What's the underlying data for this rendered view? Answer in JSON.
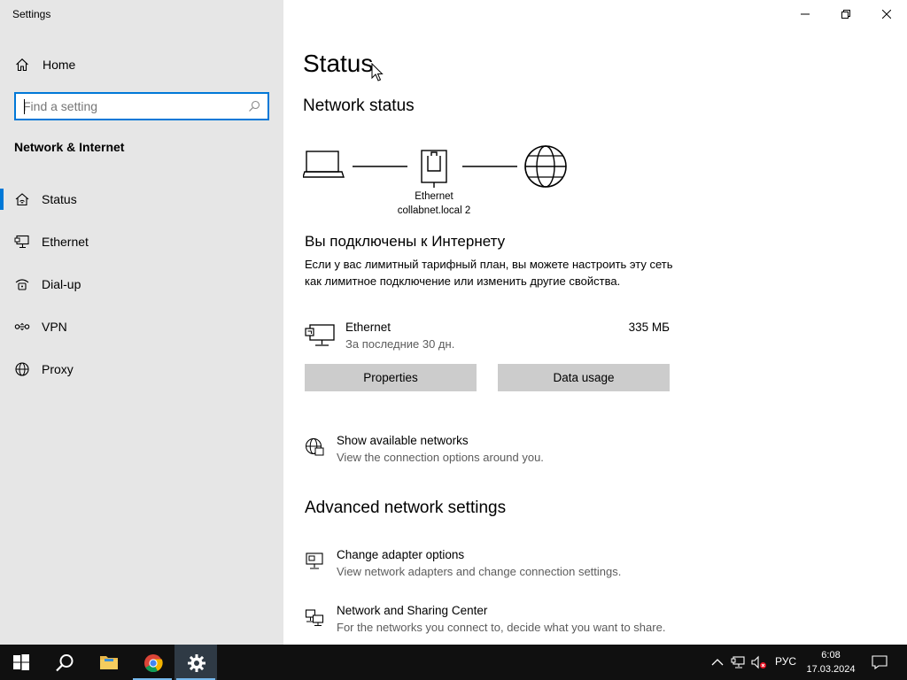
{
  "window": {
    "title": "Settings"
  },
  "sidebar": {
    "home_label": "Home",
    "search_placeholder": "Find a setting",
    "section_title": "Network & Internet",
    "items": [
      {
        "label": "Status",
        "icon": "home-wifi-icon",
        "active": true
      },
      {
        "label": "Ethernet",
        "icon": "ethernet-icon"
      },
      {
        "label": "Dial-up",
        "icon": "dialup-icon"
      },
      {
        "label": "VPN",
        "icon": "vpn-icon"
      },
      {
        "label": "Proxy",
        "icon": "globe-icon"
      }
    ]
  },
  "main": {
    "title": "Status",
    "network_status_heading": "Network status",
    "diagram": {
      "adapter_label": "Ethernet",
      "network_name": "collabnet.local 2"
    },
    "connected_title": "Вы подключены к Интернету",
    "connected_description": "Если у вас лимитный тарифный план, вы можете настроить эту сеть как лимитное подключение или изменить другие свойства.",
    "adapter": {
      "name": "Ethernet",
      "period": "За последние 30 дн.",
      "usage": "335 МБ"
    },
    "buttons": {
      "properties": "Properties",
      "data_usage": "Data usage"
    },
    "show_networks": {
      "title": "Show available networks",
      "subtitle": "View the connection options around you."
    },
    "advanced_heading": "Advanced network settings",
    "change_adapter": {
      "title": "Change adapter options",
      "subtitle": "View network adapters and change connection settings."
    },
    "sharing_center": {
      "title": "Network and Sharing Center",
      "subtitle": "For the networks you connect to, decide what you want to share."
    }
  },
  "taskbar": {
    "apps": [
      "start",
      "search",
      "file-explorer",
      "chrome",
      "settings"
    ],
    "language": "РУС",
    "time": "6:08",
    "date": "17.03.2024"
  },
  "colors": {
    "accent": "#0078d7",
    "sidebar_bg": "#e6e6e6",
    "button_bg": "#cccccc",
    "taskbar_bg": "#101010"
  }
}
